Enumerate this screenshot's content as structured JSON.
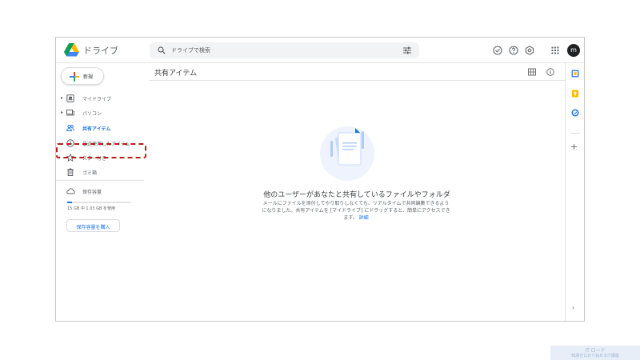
{
  "header": {
    "app_title": "ドライブ",
    "search_placeholder": "ドライブで検索",
    "avatar_letter": "m"
  },
  "sidebar": {
    "new_label": "新規",
    "items": [
      {
        "label": "マイドライブ",
        "icon": "my-drive-icon",
        "expandable": true
      },
      {
        "label": "パソコン",
        "icon": "computer-icon",
        "expandable": true
      },
      {
        "label": "共有アイテム",
        "icon": "shared-users-icon",
        "expandable": false,
        "active": true
      },
      {
        "label": "最近使用したアイテム",
        "icon": "clock-icon",
        "expandable": false
      },
      {
        "label": "スター付き",
        "icon": "star-icon",
        "expandable": false
      },
      {
        "label": "ゴミ箱",
        "icon": "trash-icon",
        "expandable": false
      }
    ],
    "storage": {
      "label": "保存容量",
      "usage_text": "15 GB 中 1.03 GB を使用",
      "used_fraction": 0.07,
      "buy_label": "保存容量を購入"
    }
  },
  "main": {
    "title": "共有アイテム",
    "empty_title": "他のユーザーがあなたと共有しているファイルやフォルダ",
    "empty_desc_line1": "メールにファイルを添付してやり取りしなくても、リアルタイムで共同編集できるよう",
    "empty_desc_line2": "になりました。共有アイテムを [マイドライブ] にドラッグすると、簡単にアクセスでき",
    "empty_desc_line3": "ます。",
    "empty_desc_link": "詳細"
  },
  "watermark": {
    "line1": "IT ロード",
    "line2": "知識ゼロから始めるIT講座"
  },
  "colors": {
    "accent": "#1a73e8",
    "highlight_border": "#b71c1c",
    "avatar_bg": "#202124"
  }
}
